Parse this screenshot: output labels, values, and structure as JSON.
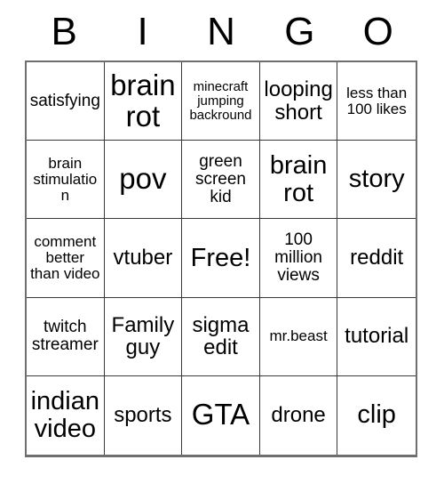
{
  "card": {
    "header_letters": [
      "B",
      "I",
      "N",
      "G",
      "O"
    ],
    "columns": 5,
    "rows": 5,
    "free_space_label": "Free!",
    "colors": {
      "background": "#ffffff",
      "text": "#000000",
      "grid_line": "#3a3a3a",
      "outer_border": "#6e6e6e"
    },
    "cells": [
      {
        "text": "satisfying",
        "size": "sm"
      },
      {
        "text": "brain rot",
        "size": "xl"
      },
      {
        "text": "minecraft jumping backround",
        "size": "xxs"
      },
      {
        "text": "looping short",
        "size": "md"
      },
      {
        "text": "less than 100 likes",
        "size": "xs"
      },
      {
        "text": "brain stimulation",
        "size": "xs"
      },
      {
        "text": "pov",
        "size": "xl"
      },
      {
        "text": "green screen kid",
        "size": "sm"
      },
      {
        "text": "brain rot",
        "size": "lg"
      },
      {
        "text": "story",
        "size": "lg"
      },
      {
        "text": "comment better than video",
        "size": "xs"
      },
      {
        "text": "vtuber",
        "size": "md"
      },
      {
        "text": "Free!",
        "size": "lg"
      },
      {
        "text": "100 million views",
        "size": "sm"
      },
      {
        "text": "reddit",
        "size": "md"
      },
      {
        "text": "twitch streamer",
        "size": "sm"
      },
      {
        "text": "Family guy",
        "size": "md"
      },
      {
        "text": "sigma edit",
        "size": "md"
      },
      {
        "text": "mr.beast",
        "size": "xs"
      },
      {
        "text": "tutorial",
        "size": "md"
      },
      {
        "text": "indian video",
        "size": "lg"
      },
      {
        "text": "sports",
        "size": "md"
      },
      {
        "text": "GTA",
        "size": "xl"
      },
      {
        "text": "drone",
        "size": "md"
      },
      {
        "text": "clip",
        "size": "lg"
      }
    ]
  }
}
